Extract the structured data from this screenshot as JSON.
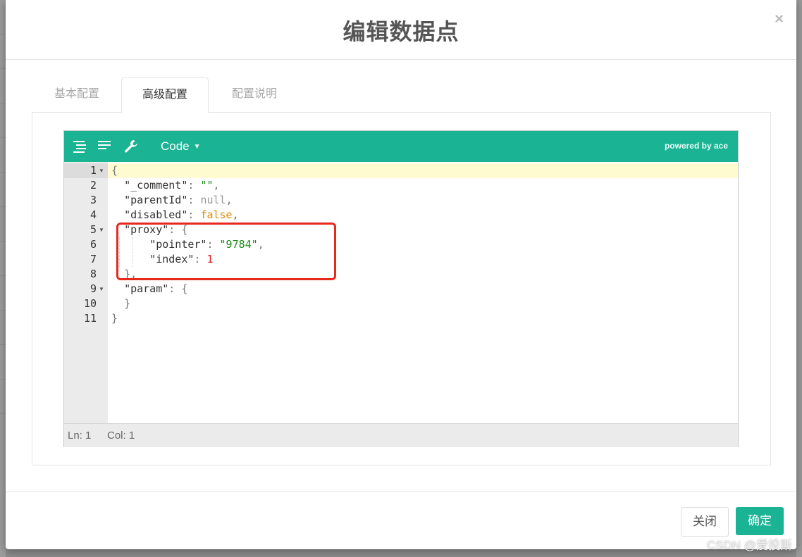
{
  "modal": {
    "title": "编辑数据点",
    "close_glyph": "×"
  },
  "tabs": [
    {
      "label": "基本配置",
      "active": false
    },
    {
      "label": "高级配置",
      "active": true
    },
    {
      "label": "配置说明",
      "active": false
    }
  ],
  "editor": {
    "toolbar": {
      "icons": [
        "format-icon",
        "compact-icon",
        "repair-icon"
      ],
      "mode_label": "Code",
      "mode_caret": "▼",
      "powered_by": "powered by ace"
    },
    "line_numbers": [
      "1",
      "2",
      "3",
      "4",
      "5",
      "6",
      "7",
      "8",
      "9",
      "10",
      "11"
    ],
    "code_lines": [
      "{",
      "  \"_comment\": \"\",",
      "  \"parentId\": null,",
      "  \"disabled\": false,",
      "  \"proxy\": {",
      "      \"pointer\": \"9784\",",
      "      \"index\": 1",
      "  },",
      "  \"param\": {",
      "  }",
      "}"
    ],
    "status": {
      "line": "Ln: 1",
      "col": "Col: 1"
    }
  },
  "footer": {
    "close_label": "关闭",
    "confirm_label": "确定"
  },
  "watermark": "CSDN @爱投斯",
  "colors": {
    "accent": "#1ab394",
    "highlight_box": "#e8281f",
    "string": "#1a8b1a",
    "boolean": "#e08a00",
    "number": "#e01e1e"
  }
}
